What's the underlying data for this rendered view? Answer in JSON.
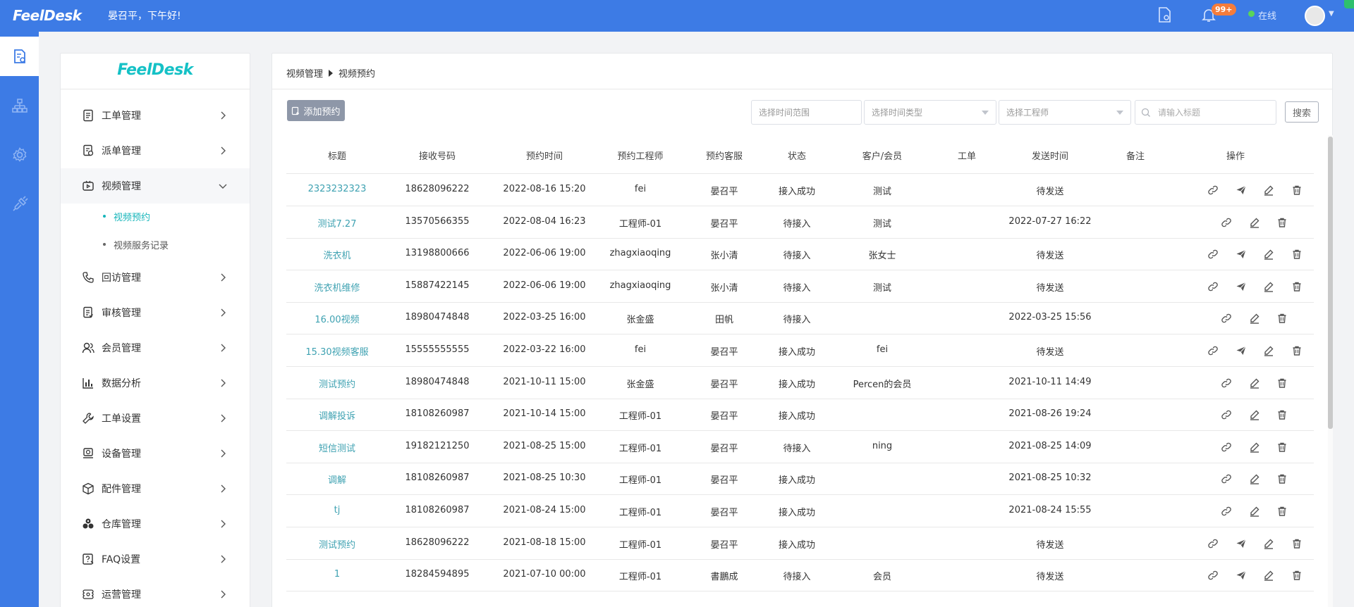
{
  "topbar": {
    "logo": "FeelDesk",
    "greeting": "晏召平，下午好!",
    "notification_count": "99+",
    "status": "在线"
  },
  "sidebar": {
    "logo": "FeelDesk",
    "menu": [
      {
        "label": "工单管理",
        "icon": "ticket-icon"
      },
      {
        "label": "派单管理",
        "icon": "dispatch-icon"
      },
      {
        "label": "视频管理",
        "icon": "video-icon"
      },
      {
        "label": "回访管理",
        "icon": "phone-icon"
      },
      {
        "label": "审核管理",
        "icon": "audit-icon"
      },
      {
        "label": "会员管理",
        "icon": "member-icon"
      },
      {
        "label": "数据分析",
        "icon": "chart-icon"
      },
      {
        "label": "工单设置",
        "icon": "wrench-icon"
      },
      {
        "label": "设备管理",
        "icon": "device-icon"
      },
      {
        "label": "配件管理",
        "icon": "box-icon"
      },
      {
        "label": "仓库管理",
        "icon": "warehouse-icon"
      },
      {
        "label": "FAQ设置",
        "icon": "faq-icon"
      },
      {
        "label": "运营管理",
        "icon": "operation-icon"
      }
    ],
    "submenu": [
      {
        "label": "视频预约"
      },
      {
        "label": "视频服务记录"
      }
    ]
  },
  "main": {
    "breadcrumb": [
      "视频管理",
      "视频预约"
    ],
    "add_button": "添加预约",
    "filters": {
      "time_range": "选择时间范围",
      "time_type": "选择时间类型",
      "engineer": "选择工程师",
      "search_placeholder": "请输入标题",
      "search_button": "搜索"
    },
    "columns": [
      "标题",
      "接收号码",
      "预约时间",
      "预约工程师",
      "预约客服",
      "状态",
      "客户/会员",
      "工单",
      "发送时间",
      "备注",
      "操作"
    ],
    "rows": [
      [
        "2323232323",
        "18628096222",
        "2022-08-16 15:20",
        "fei",
        "晏召平",
        "接入成功",
        "测试",
        "",
        "待发送",
        "",
        "4"
      ],
      [
        "测试7.27",
        "13570566355",
        "2022-08-04 16:23",
        "工程师-01",
        "晏召平",
        "待接入",
        "测试",
        "",
        "2022-07-27 16:22",
        "",
        "3"
      ],
      [
        "洗衣机",
        "13198800666",
        "2022-06-06 19:00",
        "zhagxiaoqing",
        "张小清",
        "待接入",
        "张女士",
        "",
        "待发送",
        "",
        "4"
      ],
      [
        "洗衣机维修",
        "15887422145",
        "2022-06-06 19:00",
        "zhagxiaoqing",
        "张小清",
        "待接入",
        "测试",
        "",
        "待发送",
        "",
        "4"
      ],
      [
        "16.00视频",
        "18980474848",
        "2022-03-25 16:00",
        "张金盛",
        "田帆",
        "待接入",
        "",
        "",
        "2022-03-25 15:56",
        "",
        "3"
      ],
      [
        "15.30视频客服",
        "15555555555",
        "2022-03-22 16:00",
        "fei",
        "晏召平",
        "接入成功",
        "fei",
        "",
        "待发送",
        "",
        "4"
      ],
      [
        "测试预约",
        "18980474848",
        "2021-10-11 15:00",
        "张金盛",
        "晏召平",
        "接入成功",
        "Percen的会员",
        "",
        "2021-10-11 14:49",
        "",
        "3"
      ],
      [
        "调解投诉",
        "18108260987",
        "2021-10-14 15:00",
        "工程师-01",
        "晏召平",
        "接入成功",
        "",
        "",
        "2021-08-26 19:24",
        "",
        "3"
      ],
      [
        "短信测试",
        "19182121250",
        "2021-08-25 15:00",
        "工程师-01",
        "晏召平",
        "待接入",
        "ning",
        "",
        "2021-08-25 14:09",
        "",
        "3"
      ],
      [
        "调解",
        "18108260987",
        "2021-08-25 10:30",
        "工程师-01",
        "晏召平",
        "接入成功",
        "",
        "",
        "2021-08-25 10:32",
        "",
        "3"
      ],
      [
        "tj",
        "18108260987",
        "2021-08-24 15:00",
        "工程师-01",
        "晏召平",
        "接入成功",
        "",
        "",
        "2021-08-24 15:55",
        "",
        "3"
      ],
      [
        "测试预约",
        "18628096222",
        "2021-08-18 15:00",
        "工程师-01",
        "晏召平",
        "接入成功",
        "",
        "",
        "待发送",
        "",
        "4"
      ],
      [
        "1",
        "18284594895",
        "2021-07-10 00:00",
        "工程师-01",
        "書鵬成",
        "待接入",
        "会员",
        "",
        "待发送",
        "",
        "4"
      ]
    ]
  },
  "colors": {
    "brand_blue": "#3d7be5",
    "teal_link": "#3fa2b2",
    "logo_teal": "#15c1c6",
    "badge_orange": "#f57c3b"
  }
}
